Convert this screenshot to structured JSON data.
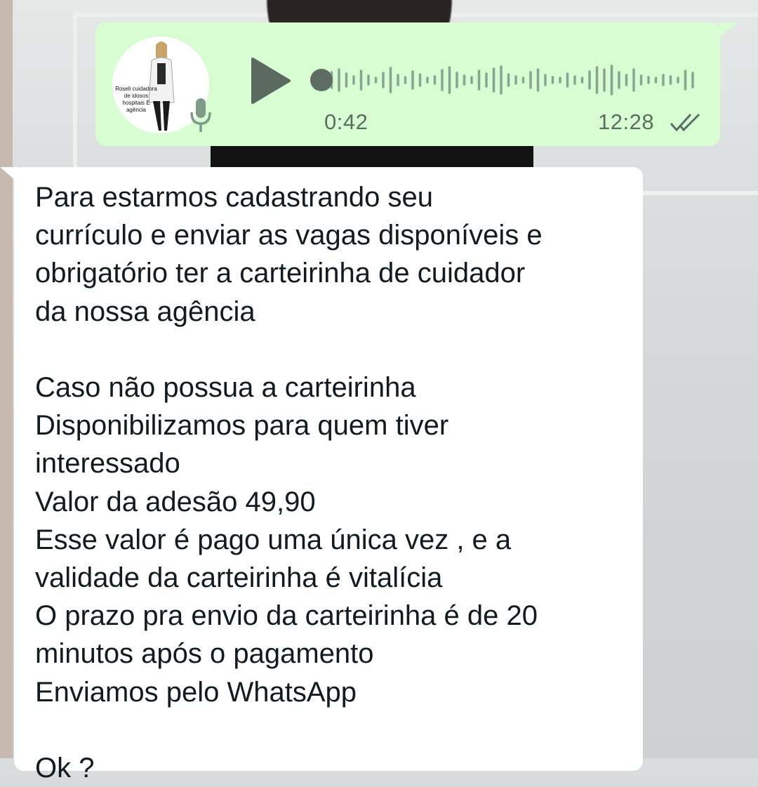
{
  "background": {
    "wallpaper_color": "#cfd3d4"
  },
  "voice_message": {
    "bubble_color": "#d8fdd2",
    "avatar": {
      "caption": "Roseli cuidadora de idosos hospitais E agência"
    },
    "duration": "0:42",
    "time": "12:28",
    "status": "read",
    "icons": {
      "play": "play-icon",
      "mic": "mic-icon",
      "ticks": "double-check-icon"
    },
    "waveform_color": "#8aa492",
    "accent_color": "#5e6d63"
  },
  "text_message": {
    "bubble_color": "#ffffff",
    "text": "Para estarmos cadastrando seu\ncurrículo e enviar as vagas disponíveis e\nobrigatório ter a carteirinha de cuidador\nda nossa agência\n\nCaso não possua a carteirinha\nDisponibilizamos para quem tiver\ninteressado\nValor da adesão 49,90\nEsse valor é pago uma única vez , e a\nvalidade da carteirinha é vitalícia\nO prazo pra envio da carteirinha é de 20\nminutos após o pagamento\nEnviamos pelo WhatsApp\n\nOk ?"
  }
}
